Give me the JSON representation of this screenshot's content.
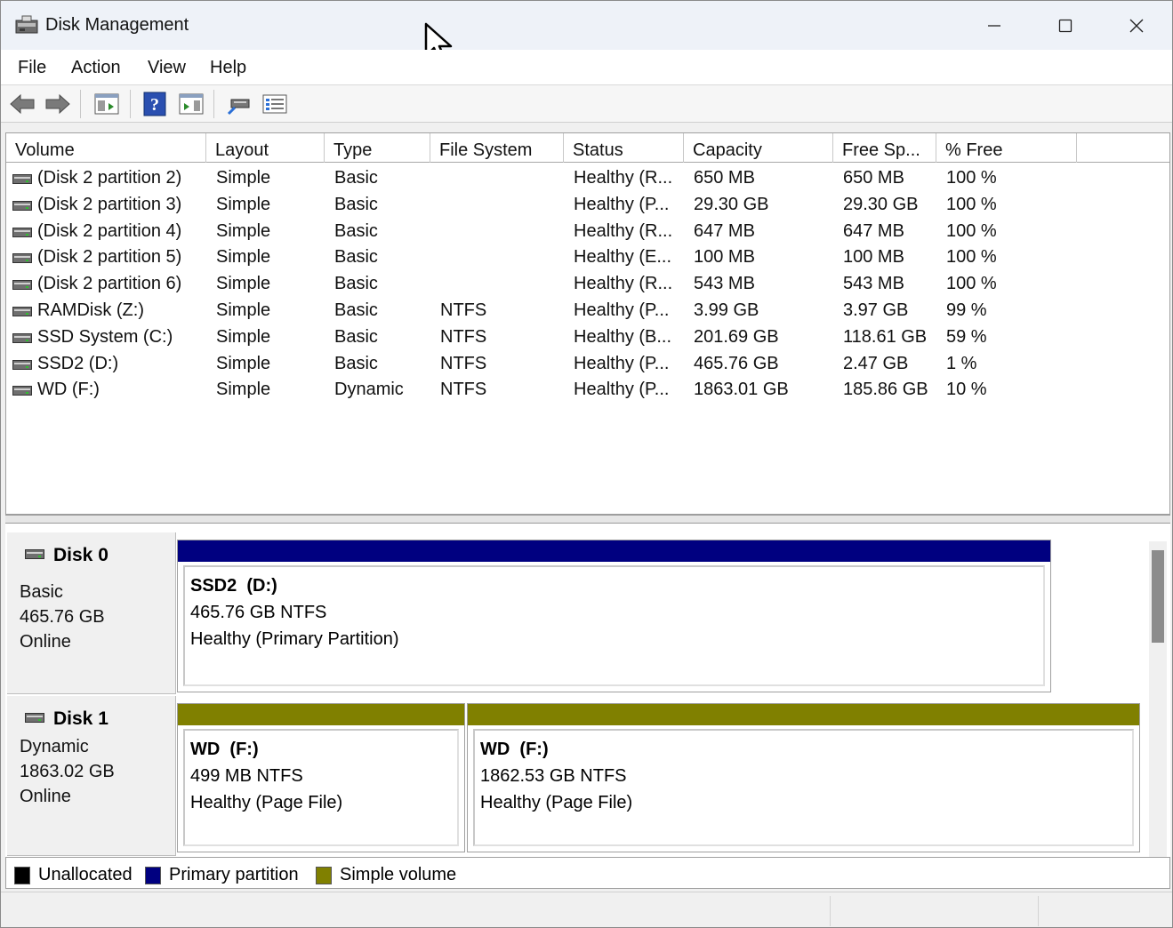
{
  "window": {
    "title": "Disk Management",
    "controls": {
      "minimize": "—",
      "maximize": "☐",
      "close": "✕"
    }
  },
  "menu": [
    "File",
    "Action",
    "View",
    "Help"
  ],
  "toolbar": {
    "icons": [
      "back-arrow-icon",
      "forward-arrow-icon",
      "console-tree-icon",
      "help-icon",
      "properties-icon",
      "connect-icon",
      "settings-list-icon"
    ]
  },
  "volume_list": {
    "columns": [
      "Volume",
      "Layout",
      "Type",
      "File System",
      "Status",
      "Capacity",
      "Free Sp...",
      "% Free"
    ],
    "rows": [
      {
        "volume": "(Disk 2 partition 2)",
        "layout": "Simple",
        "type": "Basic",
        "fs": "",
        "status": "Healthy (R...",
        "capacity": "650 MB",
        "free": "650 MB",
        "pct": "100 %"
      },
      {
        "volume": "(Disk 2 partition 3)",
        "layout": "Simple",
        "type": "Basic",
        "fs": "",
        "status": "Healthy (P...",
        "capacity": "29.30 GB",
        "free": "29.30 GB",
        "pct": "100 %"
      },
      {
        "volume": "(Disk 2 partition 4)",
        "layout": "Simple",
        "type": "Basic",
        "fs": "",
        "status": "Healthy (R...",
        "capacity": "647 MB",
        "free": "647 MB",
        "pct": "100 %"
      },
      {
        "volume": "(Disk 2 partition 5)",
        "layout": "Simple",
        "type": "Basic",
        "fs": "",
        "status": "Healthy (E...",
        "capacity": "100 MB",
        "free": "100 MB",
        "pct": "100 %"
      },
      {
        "volume": "(Disk 2 partition 6)",
        "layout": "Simple",
        "type": "Basic",
        "fs": "",
        "status": "Healthy (R...",
        "capacity": "543 MB",
        "free": "543 MB",
        "pct": "100 %"
      },
      {
        "volume": "RAMDisk (Z:)",
        "layout": "Simple",
        "type": "Basic",
        "fs": "NTFS",
        "status": "Healthy (P...",
        "capacity": "3.99 GB",
        "free": "3.97 GB",
        "pct": "99 %"
      },
      {
        "volume": "SSD System (C:)",
        "layout": "Simple",
        "type": "Basic",
        "fs": "NTFS",
        "status": "Healthy (B...",
        "capacity": "201.69 GB",
        "free": "118.61 GB",
        "pct": "59 %"
      },
      {
        "volume": "SSD2 (D:)",
        "layout": "Simple",
        "type": "Basic",
        "fs": "NTFS",
        "status": "Healthy (P...",
        "capacity": "465.76 GB",
        "free": "2.47 GB",
        "pct": "1 %"
      },
      {
        "volume": "WD (F:)",
        "layout": "Simple",
        "type": "Dynamic",
        "fs": "NTFS",
        "status": "Healthy (P...",
        "capacity": "1863.01 GB",
        "free": "185.86 GB",
        "pct": "10 %"
      }
    ]
  },
  "disks": [
    {
      "name": "Disk 0",
      "kind": "Basic",
      "size": "465.76 GB",
      "state": "Online",
      "partitions": [
        {
          "title": "SSD2  (D:)",
          "detail": "465.76 GB NTFS",
          "status": "Healthy (Primary Partition)",
          "color": "#000080"
        }
      ]
    },
    {
      "name": "Disk 1",
      "kind": "Dynamic",
      "size": "1863.02 GB",
      "state": "Online",
      "partitions": [
        {
          "title": "WD  (F:)",
          "detail": "499 MB NTFS",
          "status": "Healthy (Page File)",
          "color": "#808000"
        },
        {
          "title": "WD  (F:)",
          "detail": "1862.53 GB NTFS",
          "status": "Healthy (Page File)",
          "color": "#808000"
        }
      ]
    }
  ],
  "legend": [
    {
      "label": "Unallocated",
      "color": "#000000"
    },
    {
      "label": "Primary partition",
      "color": "#000080"
    },
    {
      "label": "Simple volume",
      "color": "#808000"
    }
  ]
}
